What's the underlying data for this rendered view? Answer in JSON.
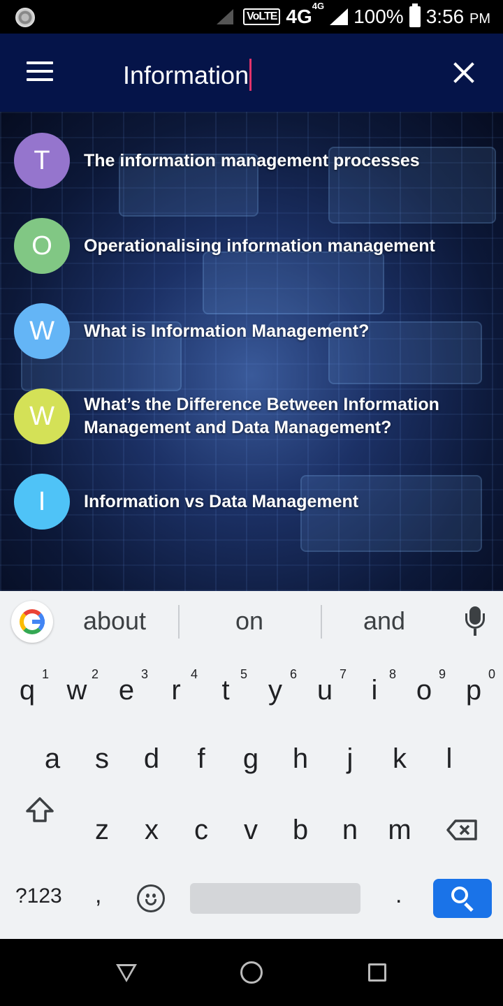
{
  "status_bar": {
    "volte": "VoLTE",
    "network": "4G",
    "network_small": "4G",
    "battery": "100%",
    "time": "3:56",
    "ampm": "PM"
  },
  "app_bar": {
    "search_query": "Information"
  },
  "results": [
    {
      "initial": "T",
      "title": "The information management processes",
      "color": "#9575cd"
    },
    {
      "initial": "O",
      "title": "Operationalising information management",
      "color": "#81c784"
    },
    {
      "initial": "W",
      "title": "What is Information Management?",
      "color": "#64b5f6"
    },
    {
      "initial": "W",
      "title": "What’s the Difference Between Information Management and Data Management?",
      "color": "#d4e157"
    },
    {
      "initial": "I",
      "title": "Information vs Data Management",
      "color": "#4fc3f7"
    }
  ],
  "keyboard": {
    "suggestions": [
      "about",
      "on",
      "and"
    ],
    "row1": [
      "q",
      "w",
      "e",
      "r",
      "t",
      "y",
      "u",
      "i",
      "o",
      "p"
    ],
    "row1_hints": [
      "1",
      "2",
      "3",
      "4",
      "5",
      "6",
      "7",
      "8",
      "9",
      "0"
    ],
    "row2": [
      "a",
      "s",
      "d",
      "f",
      "g",
      "h",
      "j",
      "k",
      "l"
    ],
    "row3": [
      "z",
      "x",
      "c",
      "v",
      "b",
      "n",
      "m"
    ],
    "symbols_label": "?123",
    "comma": ",",
    "period": ".",
    "accent_color": "#1a73e8"
  }
}
